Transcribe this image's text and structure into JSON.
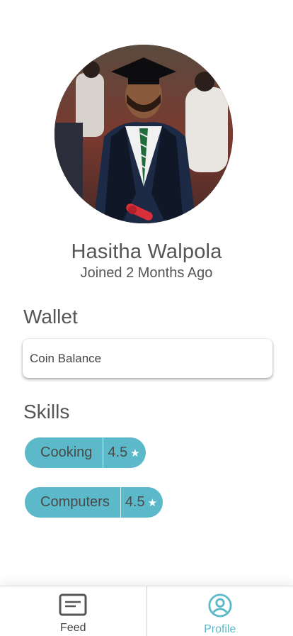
{
  "profile": {
    "name": "Hasitha Walpola",
    "joined": "Joined 2 Months Ago",
    "photo": "graduation-portrait"
  },
  "wallet": {
    "title": "Wallet",
    "card_label": "Coin Balance"
  },
  "skills": {
    "title": "Skills",
    "items": [
      {
        "label": "Cooking",
        "rating": "4.5"
      },
      {
        "label": "Computers",
        "rating": "4.5"
      }
    ]
  },
  "tabbar": {
    "feed_label": "Feed",
    "profile_label": "Profile",
    "active": "profile"
  },
  "colors": {
    "accent": "#5bb9c9",
    "text": "#555555"
  },
  "icons": {
    "feed": "feed-icon",
    "profile": "profile-icon",
    "star": "star-icon"
  }
}
